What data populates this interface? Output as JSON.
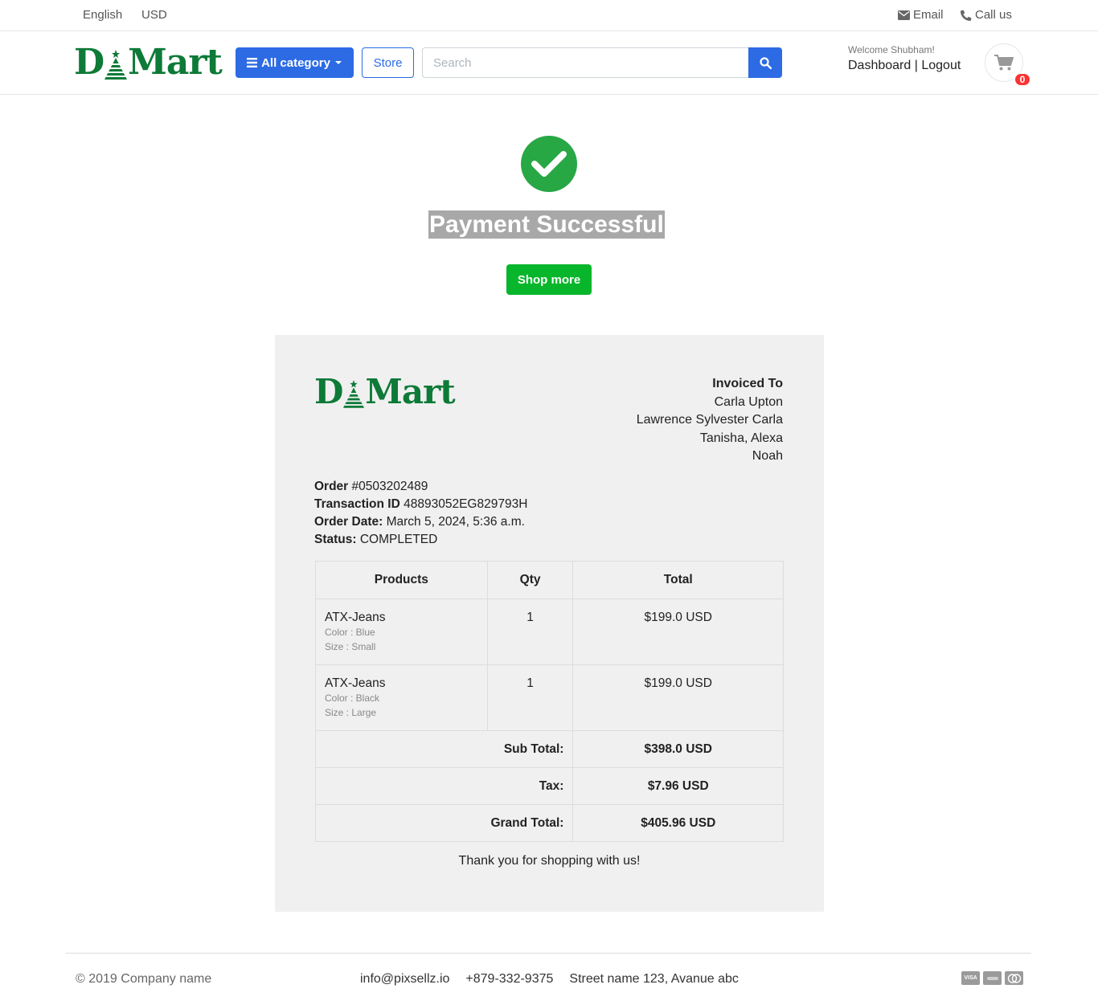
{
  "topbar": {
    "language": "English",
    "currency": "USD",
    "email_label": "Email",
    "call_label": "Call us"
  },
  "brand": {
    "logo_text_left": "D",
    "logo_text_right": "Mart",
    "color": "#0d7a37"
  },
  "header": {
    "category_button": "All category",
    "store_button": "Store",
    "search_placeholder": "Search",
    "welcome": "Welcome Shubham!",
    "dashboard_link": "Dashboard",
    "separator": "|",
    "logout_link": "Logout",
    "cart_count": "0"
  },
  "success": {
    "title": "Payment Successful",
    "shop_more": "Shop more",
    "icon": "check-circle-icon"
  },
  "invoice": {
    "invoiced_to_label": "Invoiced To",
    "address_lines": [
      "Carla Upton",
      "Lawrence Sylvester Carla",
      "Tanisha, Alexa",
      "Noah"
    ],
    "order_label": "Order",
    "order_number": "#0503202489",
    "transaction_label": "Transaction ID",
    "transaction_id": "48893052EG829793H",
    "date_label": "Order Date:",
    "date": "March 5, 2024, 5:36 a.m.",
    "status_label": "Status:",
    "status": "COMPLETED",
    "table": {
      "headers": [
        "Products",
        "Qty",
        "Total"
      ],
      "rows": [
        {
          "name": "ATX-Jeans",
          "color": "Color : Blue",
          "size": "Size : Small",
          "qty": "1",
          "total": "$199.0 USD"
        },
        {
          "name": "ATX-Jeans",
          "color": "Color : Black",
          "size": "Size : Large",
          "qty": "1",
          "total": "$199.0 USD"
        }
      ],
      "subtotal_label": "Sub Total:",
      "subtotal": "$398.0 USD",
      "tax_label": "Tax:",
      "tax": "$7.96 USD",
      "grand_total_label": "Grand Total:",
      "grand_total": "$405.96 USD"
    },
    "thanks": "Thank you for shopping with us!"
  },
  "footer": {
    "copyright": "© 2019 Company name",
    "email": "info@pixsellz.io",
    "phone": "+879-332-9375",
    "address": "Street name 123, Avanue abc",
    "payment_icons": [
      "visa-icon",
      "paypal-icon",
      "mastercard-icon"
    ]
  },
  "colors": {
    "primary": "#2d6be4",
    "success": "#28a745",
    "shop_more": "#07b62a",
    "badge": "#fa3434"
  }
}
